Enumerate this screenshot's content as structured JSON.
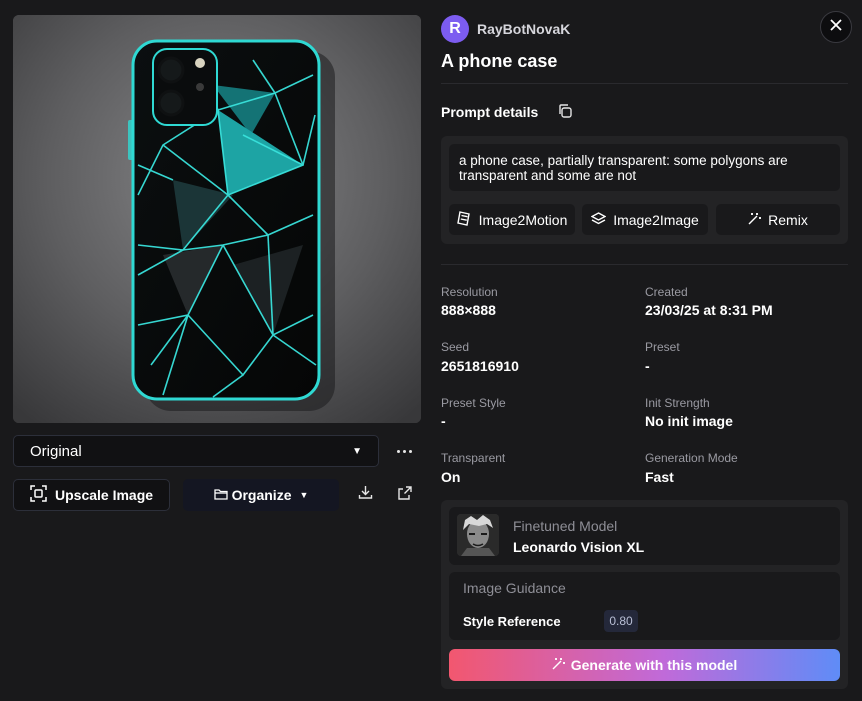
{
  "image": {
    "alt": "A phone case"
  },
  "left_panel": {
    "variant_value": "Original",
    "upscale_label": "Upscale Image",
    "organize_label": "Organize"
  },
  "header": {
    "avatar_letter": "R",
    "username": "RayBotNovaK",
    "title": "A phone case"
  },
  "prompt": {
    "label": "Prompt details",
    "text": "a phone case, partially transparent: some polygons are transparent and some are not",
    "buttons": {
      "image2motion": "Image2Motion",
      "image2image": "Image2Image",
      "remix": "Remix"
    }
  },
  "details": [
    {
      "label": "Resolution",
      "value": "888×888"
    },
    {
      "label": "Created",
      "value": "23/03/25 at 8:31 PM"
    },
    {
      "label": "Seed",
      "value": "2651816910"
    },
    {
      "label": "Preset",
      "value": "-"
    },
    {
      "label": "Preset Style",
      "value": "-"
    },
    {
      "label": "Init Strength",
      "value": "No init image"
    },
    {
      "label": "Transparent",
      "value": "On"
    },
    {
      "label": "Generation Mode",
      "value": "Fast"
    }
  ],
  "model": {
    "label": "Finetuned Model",
    "name": "Leonardo Vision XL"
  },
  "guidance": {
    "label": "Image Guidance",
    "style_reference_label": "Style Reference",
    "style_reference_value": "0.80"
  },
  "generate_label": "Generate with this model",
  "colors": {
    "background": "#19191b",
    "panel": "#232325",
    "avatar": "#7c5cf0",
    "case_edge": "#2fd9d3",
    "gradient_start": "#f2576f",
    "gradient_end": "#5f8cf7"
  }
}
